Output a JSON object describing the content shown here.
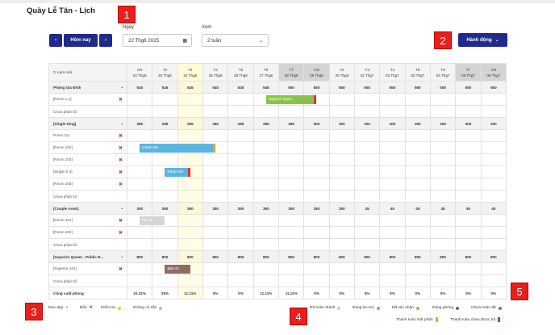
{
  "page": {
    "title": "Quầy Lễ Tân - Lịch"
  },
  "callouts": [
    "1",
    "2",
    "3",
    "4",
    "5"
  ],
  "toolbar": {
    "prev": "‹",
    "today": "Hôm nay",
    "next": "›",
    "date_label": "Ngày",
    "date_value": "22 Thg6 2025",
    "view_label": "Xem",
    "view_value": "2 tuần",
    "actions": "Hành động"
  },
  "header": {
    "refresh": "Làm mới",
    "days": [
      {
        "dow": "CN",
        "date": "22 Thg6"
      },
      {
        "dow": "T2",
        "date": "23 Thg6"
      },
      {
        "dow": "T3",
        "date": "24 Thg6"
      },
      {
        "dow": "T4",
        "date": "25 Thg6"
      },
      {
        "dow": "T5",
        "date": "26 Thg6"
      },
      {
        "dow": "T6",
        "date": "27 Thg6"
      },
      {
        "dow": "T7",
        "date": "28 Thg6"
      },
      {
        "dow": "CN",
        "date": "29 Thg6"
      },
      {
        "dow": "T2",
        "date": "30 Thg6"
      },
      {
        "dow": "T3",
        "date": "01 Thg7"
      },
      {
        "dow": "T4",
        "date": "02 Thg7"
      },
      {
        "dow": "T5",
        "date": "03 Thg7"
      },
      {
        "dow": "T6",
        "date": "04 Thg7"
      },
      {
        "dow": "T7",
        "date": "05 Thg7"
      },
      {
        "dow": "CN",
        "date": "06 Thg7"
      }
    ]
  },
  "groups": [
    {
      "name": "Phòng Gia Đình",
      "prices": [
        "545",
        "545",
        "545",
        "545",
        "545",
        "545",
        "550",
        "550",
        "550",
        "550",
        "550",
        "550",
        "550",
        "550",
        "550"
      ],
      "rooms": [
        "[Room 1.1]",
        "Chưa phân bổ"
      ]
    },
    {
      "name": "[Single King]",
      "prices": [
        "285",
        "285",
        "285",
        "285",
        "285",
        "285",
        "285",
        "300",
        "300",
        "300",
        "300",
        "300",
        "300",
        "300",
        "300"
      ],
      "rooms": [
        "Room 111",
        "[Room 102]",
        "[Room 103]",
        "[Single K 4]",
        "[Room 105]",
        "Chưa phân bổ"
      ]
    },
    {
      "name": "[Couple room]",
      "prices": [
        "350",
        "350",
        "350",
        "350",
        "350",
        "350",
        "350",
        "350",
        "350",
        "45",
        "45",
        "45",
        "45",
        "45",
        "45"
      ],
      "rooms": [
        "[Room 201]",
        "[Room 202]",
        "Chưa phân bổ"
      ]
    },
    {
      "name": "[Superior Queen - Public R...",
      "prices": [
        "800",
        "800",
        "800",
        "800",
        "800",
        "800",
        "800",
        "800",
        "800",
        "800",
        "800",
        "800",
        "800",
        "800",
        "800"
      ],
      "rooms": [
        "[Superior 101]",
        "Chưa phân bổ"
      ]
    }
  ],
  "capacity": {
    "label": "Công suất phòng",
    "values": [
      "22.22%",
      "25%",
      "11.11%",
      "0%",
      "0%",
      "11.11%",
      "11.11%",
      "0%",
      "0%",
      "0%",
      "0%",
      "0%",
      "0%",
      "0%",
      "0%"
    ]
  },
  "bookings": {
    "b1": "Nguyen Ngoc",
    "b2": "Ethan Re",
    "b3": "Ethan Re",
    "b4": "Pit Lin",
    "b5": "Bảo trì"
  },
  "legend": {
    "clean": "Dọn dẹp",
    "dirty": "Bẩn",
    "inspect": "Kiểm tra",
    "unavailable": "Không có sẵn",
    "done": "Đã hoàn thành",
    "staying": "Đang lưu trú",
    "confirmed": "Đã xác nhận",
    "closed": "Đóng phòng",
    "incomplete": "Chưa hoàn tất",
    "partial": "Thanh toán một phần",
    "unpaid": "Thanh toán chưa được trả"
  },
  "colors": {
    "navy": "#1f2a8a",
    "green": "#8bc34a",
    "blue": "#5bb5e0",
    "gray": "#cccccc",
    "brown": "#8d6e63",
    "orange": "#f0a030",
    "red": "#e3342f"
  }
}
